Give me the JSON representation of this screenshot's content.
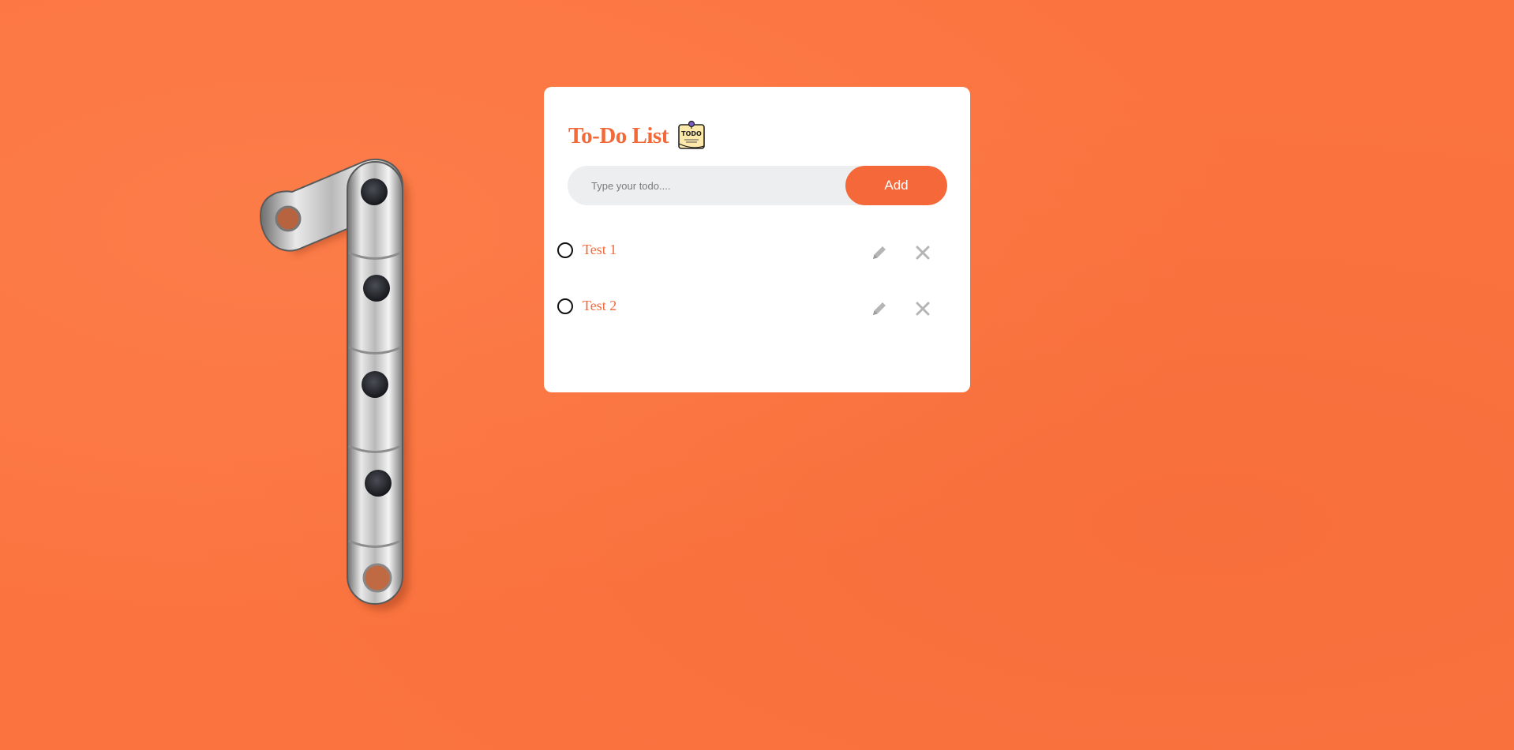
{
  "app": {
    "title": "To-Do List",
    "title_icon": "todo-note-icon",
    "title_icon_text": "TODO"
  },
  "input": {
    "placeholder": "Type your todo....",
    "value": ""
  },
  "add_button": {
    "label": "Add"
  },
  "todos": [
    {
      "text": "Test 1",
      "completed": false,
      "edit_icon": "pencil-icon",
      "delete_icon": "close-icon"
    },
    {
      "text": "Test 2",
      "completed": false,
      "edit_icon": "pencil-icon",
      "delete_icon": "close-icon"
    }
  ],
  "background": {
    "color": "#fb7440",
    "decoration": "bike-chain-number-one"
  },
  "colors": {
    "accent": "#f5683a",
    "title": "#f26a3a",
    "input_bg": "#edeef0",
    "icon_gray": "#b5b5b5"
  }
}
